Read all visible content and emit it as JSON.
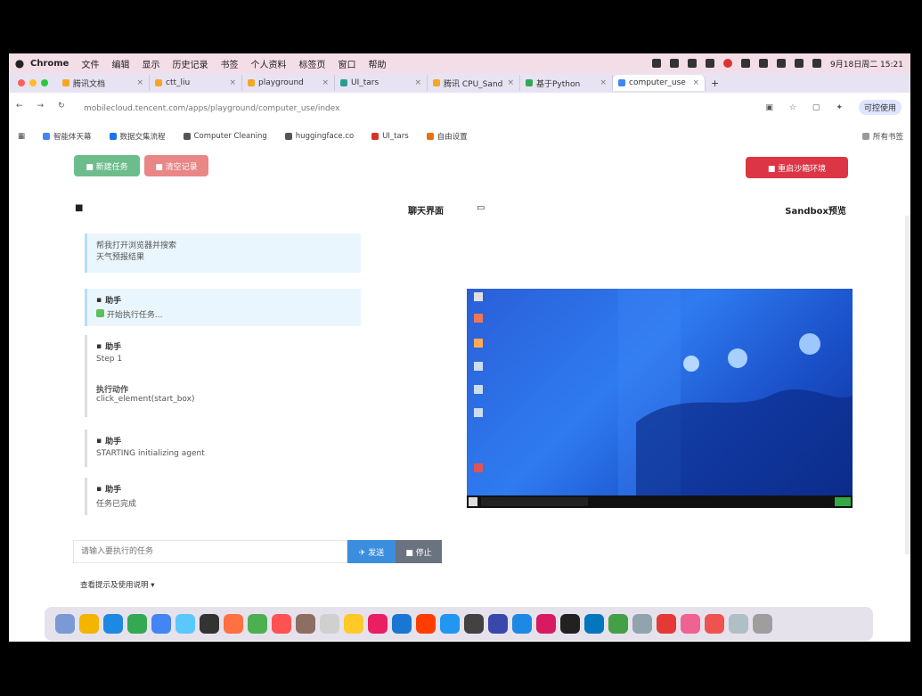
{
  "menubar": {
    "app": "Chrome",
    "items": [
      "文件",
      "编辑",
      "显示",
      "历史记录",
      "书签",
      "个人资料",
      "标签页",
      "窗口",
      "帮助"
    ],
    "clock": "9月18日周二 15:21"
  },
  "tabs": [
    {
      "label": "腾讯文档",
      "color": "#f5a623"
    },
    {
      "label": "ctt_liu",
      "color": "#f5a623"
    },
    {
      "label": "playground",
      "color": "#f5a623"
    },
    {
      "label": "UI_tars",
      "color": "#2a9d8f"
    },
    {
      "label": "腾讯 CPU_Sand",
      "color": "#f5a623"
    },
    {
      "label": "基于Python",
      "color": "#34a853"
    },
    {
      "label": "computer_use",
      "color": "#4285f4"
    }
  ],
  "address": {
    "url": "mobilecloud.tencent.com/apps/playground/computer_use/index",
    "profile": "可控使用"
  },
  "bookmarks": [
    {
      "label": "智能体天幕",
      "color": "#4285f4"
    },
    {
      "label": "数据交集流程",
      "color": "#1a73e8"
    },
    {
      "label": "Computer Cleaning",
      "color": "#555555"
    },
    {
      "label": "huggingface.co",
      "color": "#555555"
    },
    {
      "label": "UI_tars",
      "color": "#d93025"
    },
    {
      "label": "自由设置",
      "color": "#e8710a"
    },
    {
      "label": "所有书签",
      "color": "#555555"
    }
  ],
  "toolbar": {
    "green_label": "■ 新建任务",
    "red_label": "■ 清空记录",
    "danger_label": "■ 重启沙箱环境"
  },
  "chat": {
    "title": "聊天界面",
    "messages": [
      {
        "who": "",
        "lines": [
          "帮我打开浏览器并搜索",
          "天气预报结果"
        ]
      },
      {
        "who": "助手",
        "lines": [
          "开始执行任务..."
        ]
      },
      {
        "who": "助手",
        "lines": [
          "Step 1",
          "执行动作",
          "click_element(start_box)"
        ]
      },
      {
        "who": "助手",
        "lines": [
          "STARTING  initializing agent"
        ]
      },
      {
        "who": "助手",
        "lines": [
          "任务已完成"
        ]
      }
    ]
  },
  "sandbox": {
    "title": "Sandbox预览"
  },
  "input": {
    "placeholder": "请输入要执行的任务",
    "send_label": "✈ 发送",
    "stop_label": "■ 停止"
  },
  "footer": {
    "label": "查看提示及使用说明 ▾"
  },
  "dock": {
    "apps": [
      "#7a9ad6",
      "#f4b400",
      "#1e88e5",
      "#34a853",
      "#4285f4",
      "#5ac8fa",
      "#333333",
      "#ff7043",
      "#4caf50",
      "#ff5252",
      "#8d6e63",
      "#d0d0d0",
      "#ffca28",
      "#e91e63",
      "#1976d2",
      "#ff3d00",
      "#2196f3",
      "#424242",
      "#3949ab",
      "#1e88e5",
      "#d81b60",
      "#212121",
      "#0277bd",
      "#43a047",
      "#90a4ae",
      "#e53935",
      "#f06292",
      "#ef5350",
      "#b0bec5",
      "#9e9e9e"
    ]
  }
}
